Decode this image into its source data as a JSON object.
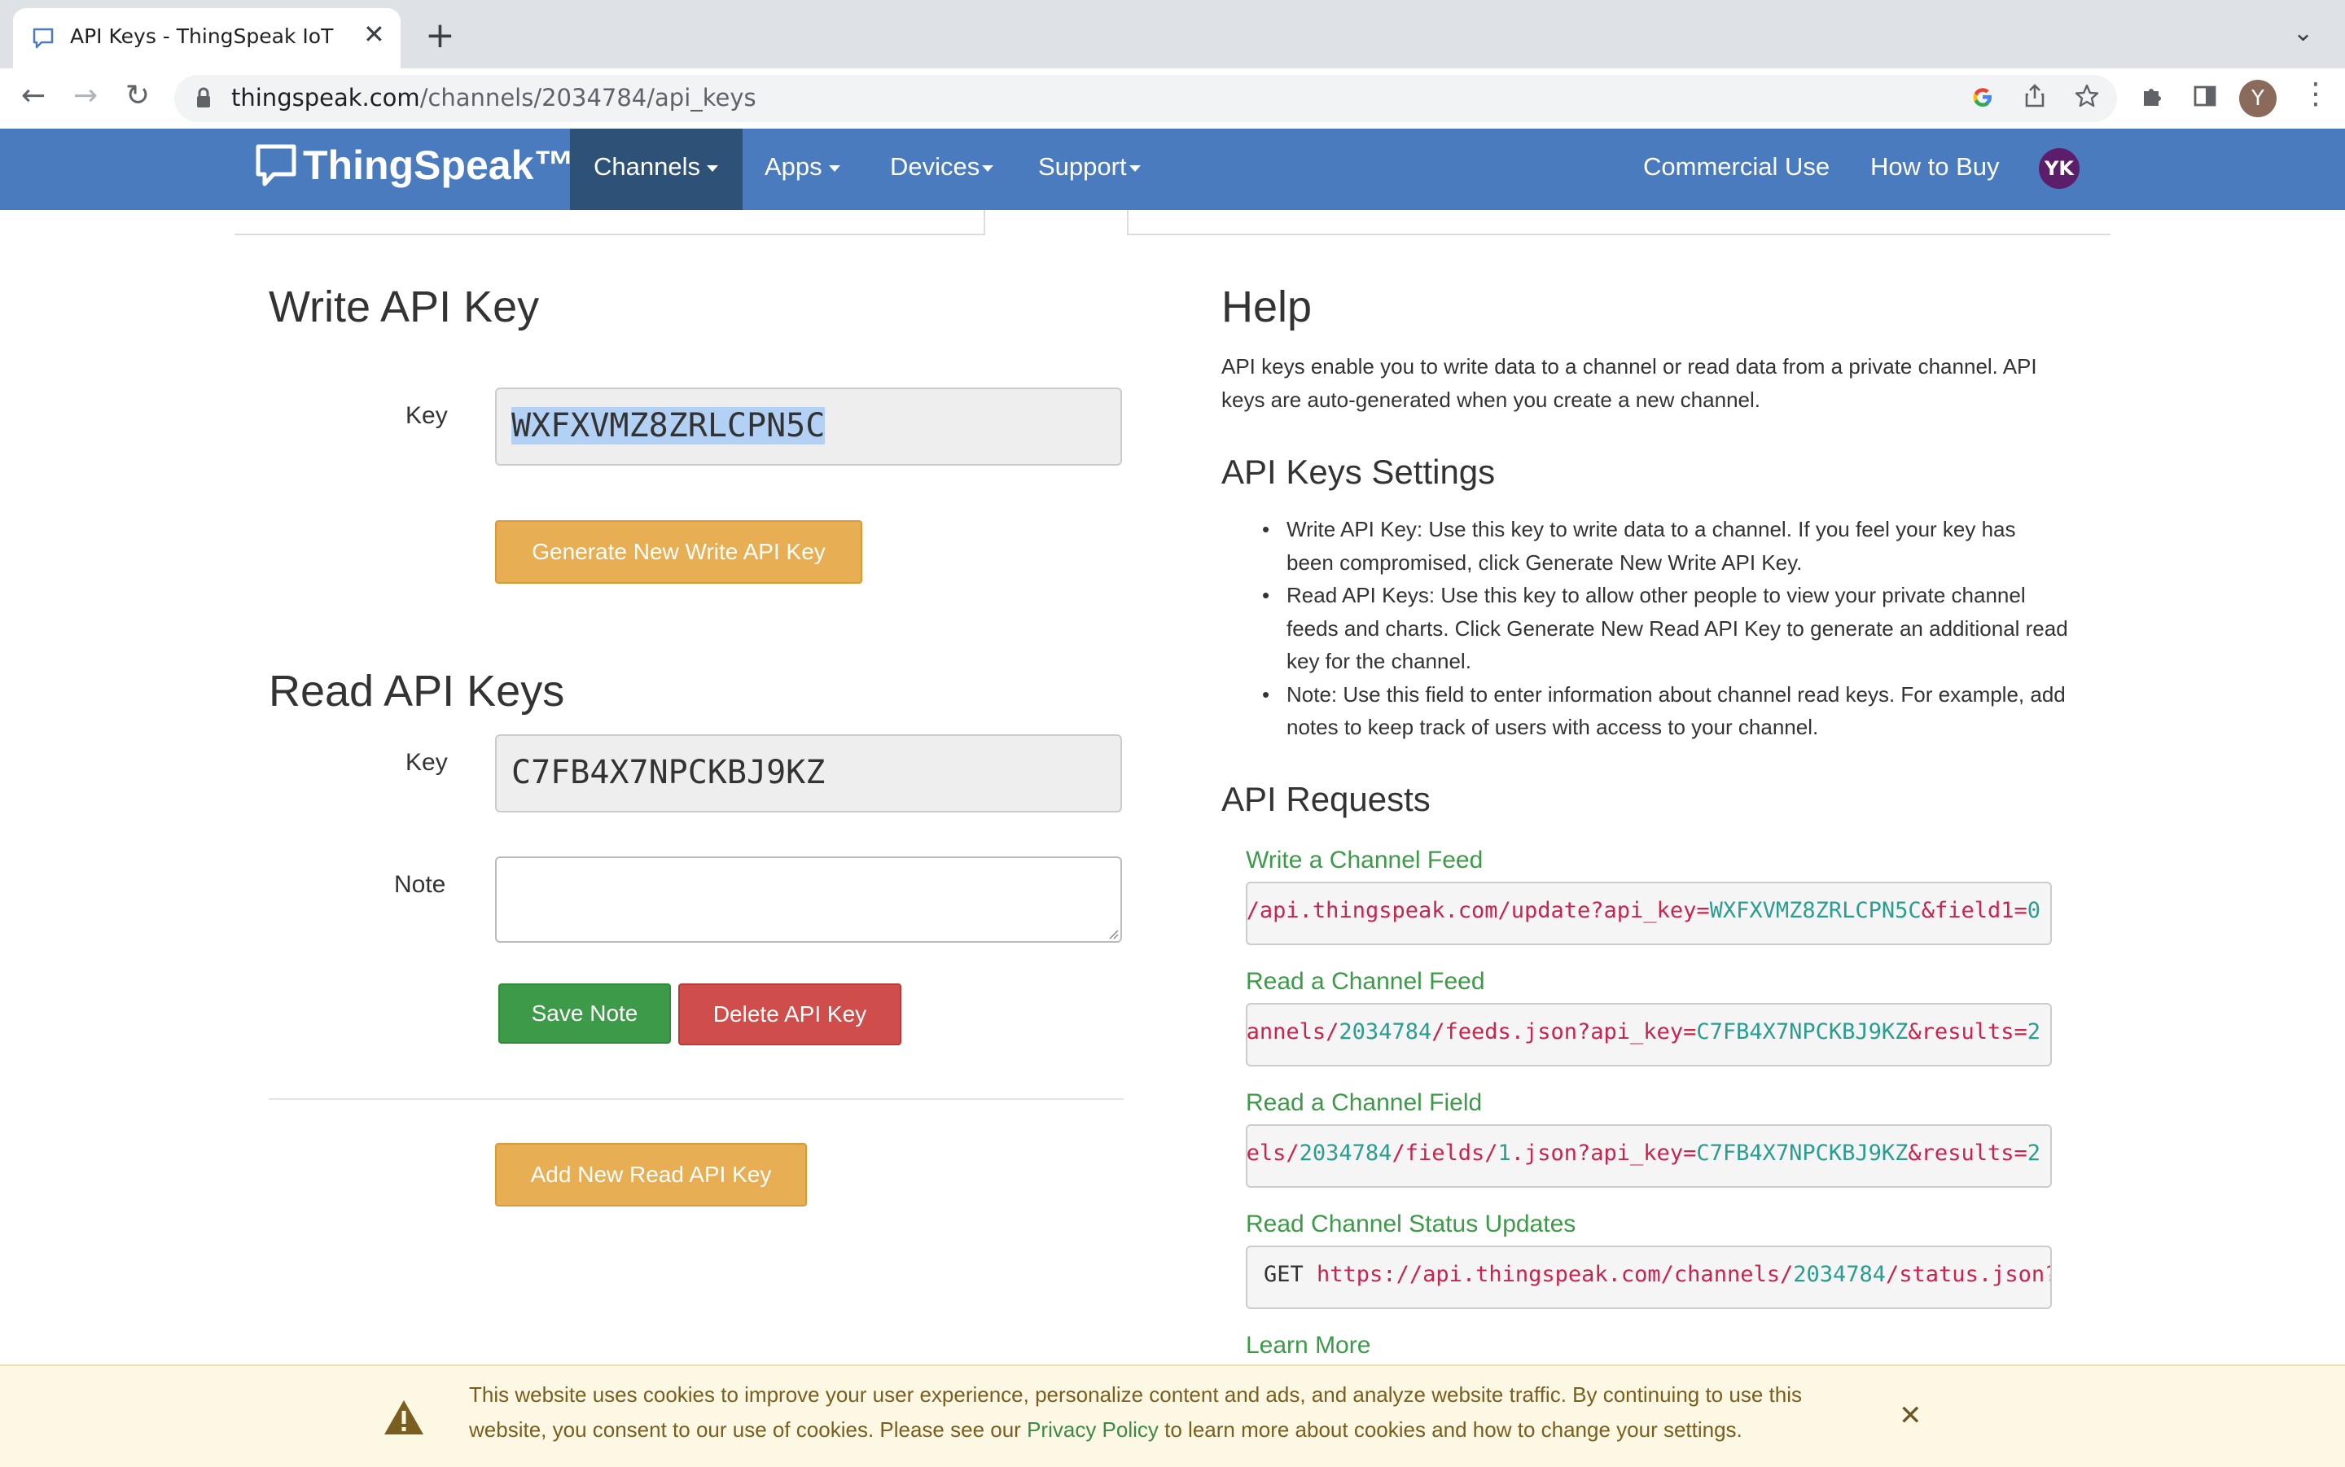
{
  "browser": {
    "tab_title": "API Keys - ThingSpeak IoT",
    "tab_close": "✕",
    "new_tab": "+",
    "tab_menu": "⌄",
    "url_host": "thingspeak.com",
    "url_path": "/channels/2034784/api_keys",
    "profile_initial": "Y",
    "nav_back": "←",
    "nav_forward": "→",
    "nav_reload": "↻",
    "menu": "⋮"
  },
  "header": {
    "logo": "ThingSpeak™",
    "nav": {
      "channels": "Channels",
      "apps": "Apps",
      "devices": "Devices",
      "support": "Support",
      "commercial": "Commercial Use",
      "how_to_buy": "How to Buy",
      "user_initials": "YK"
    }
  },
  "write_api": {
    "title": "Write API Key",
    "key_label": "Key",
    "key_value": "WXFXVMZ8ZRLCPN5C",
    "generate_button": "Generate New Write API Key"
  },
  "read_api": {
    "title": "Read API Keys",
    "key_label": "Key",
    "key_value": "C7FB4X7NPCKBJ9KZ",
    "note_label": "Note",
    "note_value": "",
    "save_button": "Save Note",
    "delete_button": "Delete API Key",
    "add_button": "Add New Read API Key"
  },
  "help": {
    "title": "Help",
    "intro": "API keys enable you to write data to a channel or read data from a private channel. API keys are auto-generated when you create a new channel.",
    "settings_title": "API Keys Settings",
    "settings_items": [
      "Write API Key: Use this key to write data to a channel. If you feel your key has been compromised, click Generate New Write API Key.",
      "Read API Keys: Use this key to allow other people to view your private channel feeds and charts. Click Generate New Read API Key to generate an additional read key for the channel.",
      "Note: Use this field to enter information about channel read keys. For example, add notes to keep track of users with access to your channel."
    ],
    "requests_title": "API Requests",
    "requests": [
      {
        "label": "Write a Channel Feed",
        "code": [
          {
            "t": "://api.thingspeak.com/update?api_key=",
            "c": "red"
          },
          {
            "t": "WXFXVMZ8ZRLCPN5C",
            "c": "teal"
          },
          {
            "t": "&field1=",
            "c": "red"
          },
          {
            "t": "0",
            "c": "teal"
          }
        ]
      },
      {
        "label": "Read a Channel Feed",
        "code": [
          {
            "t": "channels/",
            "c": "red"
          },
          {
            "t": "2034784",
            "c": "teal"
          },
          {
            "t": "/feeds.json?api_key=",
            "c": "red"
          },
          {
            "t": "C7FB4X7NPCKBJ9KZ",
            "c": "teal"
          },
          {
            "t": "&results=",
            "c": "red"
          },
          {
            "t": "2",
            "c": "teal"
          }
        ]
      },
      {
        "label": "Read a Channel Field",
        "code": [
          {
            "t": "nnels/",
            "c": "red"
          },
          {
            "t": "2034784",
            "c": "teal"
          },
          {
            "t": "/fields/",
            "c": "red"
          },
          {
            "t": "1",
            "c": "teal"
          },
          {
            "t": ".json?api_key=",
            "c": "red"
          },
          {
            "t": "C7FB4X7NPCKBJ9KZ",
            "c": "teal"
          },
          {
            "t": "&results=",
            "c": "red"
          },
          {
            "t": "2",
            "c": "teal"
          }
        ]
      },
      {
        "label": "Read Channel Status Updates",
        "code": [
          {
            "t": "GET ",
            "c": "dark"
          },
          {
            "t": "https://api.thingspeak.com/channels/",
            "c": "red"
          },
          {
            "t": "2034784",
            "c": "teal"
          },
          {
            "t": "/status.json?ap",
            "c": "red"
          }
        ]
      }
    ],
    "learn_more": "Learn More"
  },
  "cookie_banner": {
    "text_before": "This website uses cookies to improve your user experience, personalize content and ads, and analyze website traffic. By continuing to use this website, you consent to our use of cookies. Please see our ",
    "link": "Privacy Policy",
    "text_after": " to learn more about cookies and how to change your settings.",
    "close": "✕"
  },
  "colors": {
    "nav_bg": "#4a7bbf",
    "nav_active": "#2e5178",
    "warning_button": "#e8ae53",
    "success_button": "#3d9a48",
    "danger_button": "#cf4d4a",
    "link_green": "#3d9a48",
    "code_red": "#c7254e",
    "code_teal": "#2a9d8f",
    "cookie_bg": "#fcf8e3"
  },
  "icons": [
    "chat-bubble-icon",
    "lock-icon",
    "google-icon",
    "share-icon",
    "star-icon",
    "puzzle-icon",
    "sidebar-icon",
    "warning-icon",
    "close-icon"
  ]
}
